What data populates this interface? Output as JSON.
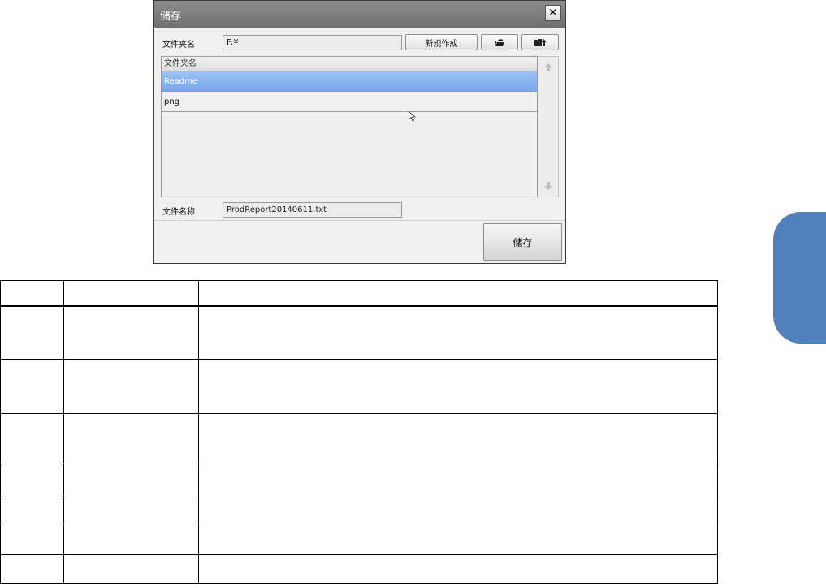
{
  "dialog": {
    "title": "储存",
    "close_label": "✕",
    "folder_label": "文件夹名",
    "folder_value": "F:¥",
    "new_folder_label": "新规作成",
    "list_header": "文件夹名",
    "items": [
      {
        "name": "Readme",
        "selected": true
      },
      {
        "name": "png",
        "selected": false
      }
    ],
    "filename_label": "文件名称",
    "filename_value": "ProdReport20140611.txt",
    "save_label": "储存"
  },
  "colors": {
    "selection": "#7aaaf0",
    "side_tab": "#4f81bd"
  },
  "icons": [
    "open-folder-icon",
    "folder-up-icon",
    "scroll-up-arrow-icon",
    "scroll-down-arrow-icon",
    "mouse-cursor-icon"
  ]
}
